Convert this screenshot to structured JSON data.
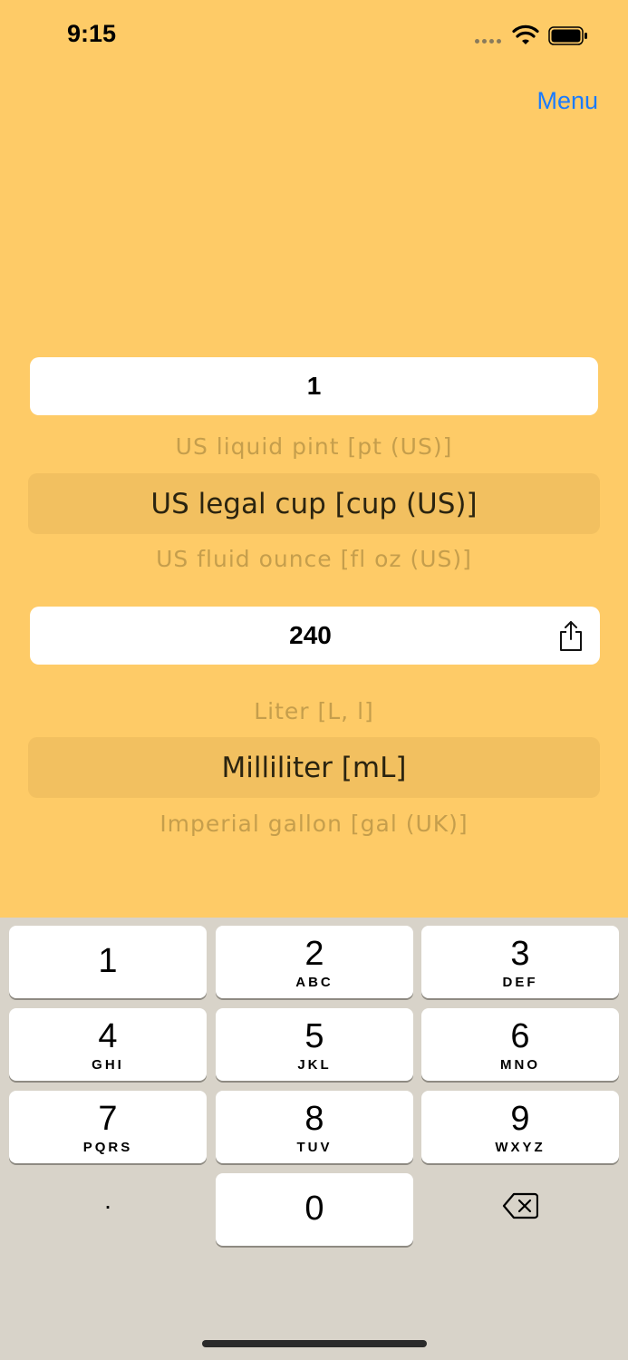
{
  "status": {
    "time": "9:15"
  },
  "nav": {
    "menu_label": "Menu"
  },
  "converter": {
    "input_value": "1",
    "from_units": {
      "above": "US liquid pint [pt (US)]",
      "selected": "US legal cup [cup (US)]",
      "below": "US fluid ounce [fl oz (US)]"
    },
    "output_value": "240",
    "to_units": {
      "above": "Liter [L, l]",
      "selected": "Milliliter [mL]",
      "below": "Imperial gallon [gal (UK)]"
    }
  },
  "keyboard": {
    "keys": [
      {
        "digit": "1",
        "letters": ""
      },
      {
        "digit": "2",
        "letters": "ABC"
      },
      {
        "digit": "3",
        "letters": "DEF"
      },
      {
        "digit": "4",
        "letters": "GHI"
      },
      {
        "digit": "5",
        "letters": "JKL"
      },
      {
        "digit": "6",
        "letters": "MNO"
      },
      {
        "digit": "7",
        "letters": "PQRS"
      },
      {
        "digit": "8",
        "letters": "TUV"
      },
      {
        "digit": "9",
        "letters": "WXYZ"
      },
      {
        "digit": "0",
        "letters": ""
      }
    ],
    "decimal_label": "."
  },
  "icons": {
    "share": "share-icon",
    "delete": "backspace-icon",
    "wifi": "wifi-icon",
    "battery": "battery-icon"
  },
  "colors": {
    "background": "#FECB67",
    "accent": "#1a7bff",
    "keyboard_bg": "#D8D3C9"
  }
}
